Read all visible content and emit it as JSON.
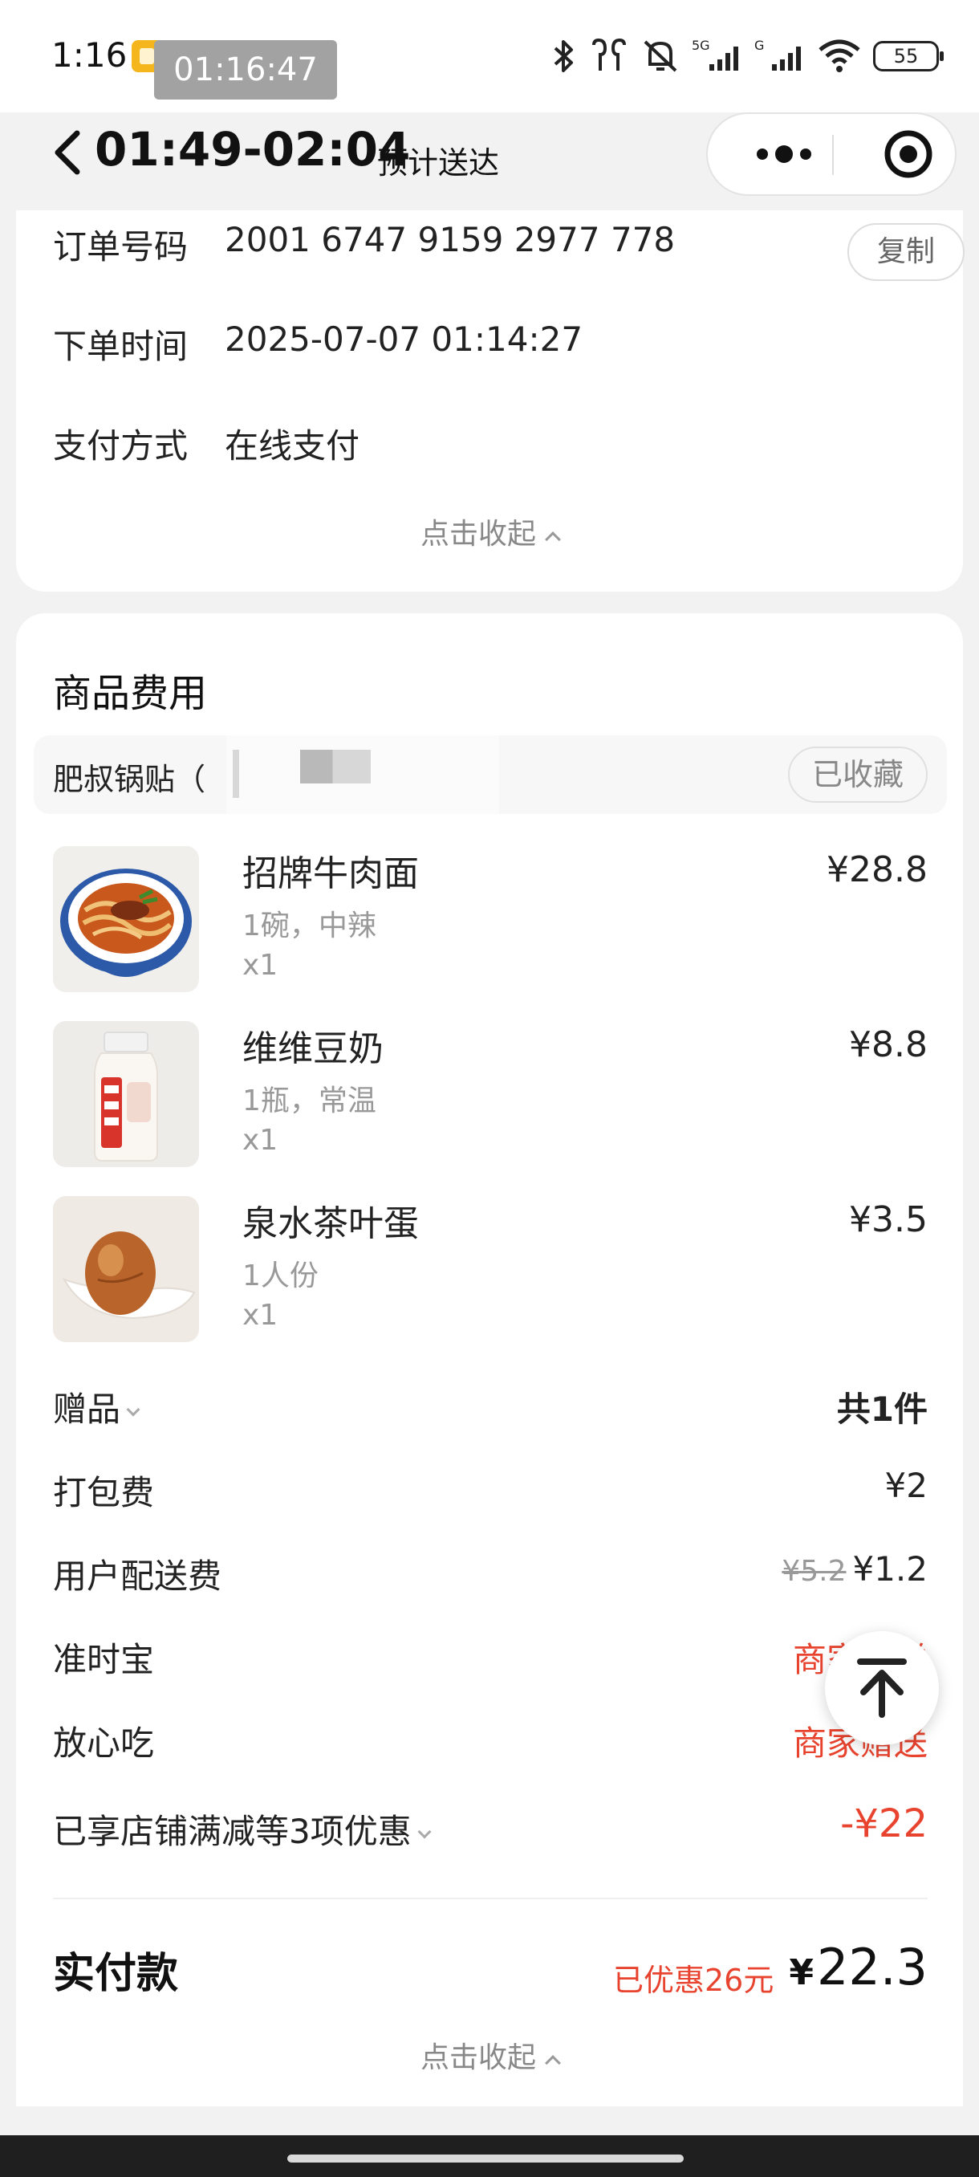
{
  "status_bar": {
    "time": "1:16",
    "dots": "···",
    "overlay_time": "01:16:47",
    "battery": "55"
  },
  "header": {
    "eta": "01:49-02:04",
    "eta_label": "预计送达"
  },
  "order_info": {
    "rows": [
      {
        "label": "订单号码",
        "value": "2001 6747 9159 2977 778"
      },
      {
        "label": "下单时间",
        "value": "2025-07-07 01:14:27"
      },
      {
        "label": "支付方式",
        "value": "在线支付"
      }
    ],
    "copy_label": "复制",
    "collapse_label": "点击收起"
  },
  "cost": {
    "title": "商品费用",
    "shop_name": "肥叔锅贴（",
    "fav_label": "已收藏",
    "items": [
      {
        "name": "招牌牛肉面",
        "spec": "1碗，中辣",
        "qty": "x1",
        "price": "¥28.8"
      },
      {
        "name": "维维豆奶",
        "spec": "1瓶，常温",
        "qty": "x1",
        "price": "¥8.8"
      },
      {
        "name": "泉水茶叶蛋",
        "spec": "1人份",
        "qty": "x1",
        "price": "¥3.5"
      }
    ],
    "fees": {
      "gift": {
        "label": "赠品",
        "value": "共1件"
      },
      "packing": {
        "label": "打包费",
        "value": "¥2"
      },
      "delivery": {
        "label": "用户配送费",
        "original": "¥5.2",
        "value": "¥1.2"
      },
      "ontime": {
        "label": "准时宝",
        "value": "商家赠送"
      },
      "safe": {
        "label": "放心吃",
        "value": "商家赠送"
      },
      "discounts": {
        "label": "已享店铺满减等3项优惠",
        "value": "-¥22"
      }
    },
    "total": {
      "label": "实付款",
      "discount_note": "已优惠26元",
      "currency": "¥",
      "amount": "22.3"
    },
    "collapse_label": "点击收起"
  },
  "colors": {
    "accent_red": "#e8432e",
    "text_primary": "#222222",
    "text_secondary": "#999999",
    "page_bg": "#f2f2f2"
  },
  "icons": {
    "back": "chevron-left-icon",
    "more": "more-dots-icon",
    "close": "target-circle-icon",
    "to_top": "arrow-up-to-top-icon"
  }
}
